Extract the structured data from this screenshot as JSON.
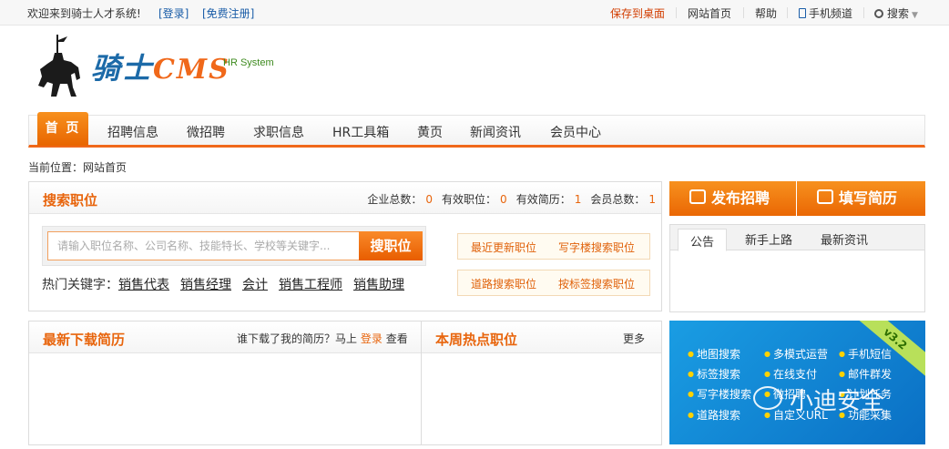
{
  "topbar": {
    "welcome": "欢迎来到骑士人才系统!",
    "login": "[登录]",
    "register": "[免费注册]",
    "save_desktop": "保存到桌面",
    "site_home": "网站首页",
    "help": "帮助",
    "mobile": "手机频道",
    "search": "搜索"
  },
  "logo": {
    "brand": "骑士",
    "brand_cms": "CMS",
    "tagline": "HR System"
  },
  "nav": {
    "items": [
      "首 页",
      "招聘信息",
      "微招聘",
      "求职信息",
      "HR工具箱",
      "黄页",
      "新闻资讯",
      "会员中心"
    ]
  },
  "breadcrumb": "当前位置：网站首页",
  "search_panel": {
    "title": "搜索职位",
    "stats": [
      {
        "label": "企业总数：",
        "value": "0"
      },
      {
        "label": "有效职位：",
        "value": "0"
      },
      {
        "label": "有效简历：",
        "value": "1"
      },
      {
        "label": "会员总数：",
        "value": "1"
      }
    ],
    "placeholder": "请输入职位名称、公司名称、技能特长、学校等关键字...",
    "button": "搜职位",
    "hot_label": "热门关键字：",
    "hot_keywords": [
      "销售代表",
      "销售经理",
      "会计",
      "销售工程师",
      "销售助理"
    ],
    "quick_links": [
      "最近更新职位",
      "写字楼搜索职位",
      "道路搜索职位",
      "按标签搜索职位"
    ]
  },
  "actions": {
    "post_job": "发布招聘",
    "write_resume": "填写简历"
  },
  "notice": {
    "tabs": [
      "公告",
      "新手上路",
      "最新资讯"
    ]
  },
  "downloads": {
    "title": "最新下载简历",
    "who_prefix": "谁下载了我的简历？马上",
    "who_login": "登录",
    "who_suffix": "查看"
  },
  "hot_jobs": {
    "title": "本周热点职位",
    "more": "更多"
  },
  "banner": {
    "version": "v3.2",
    "features": [
      "地图搜索",
      "多模式运营",
      "手机短信",
      "标签搜索",
      "在线支付",
      "邮件群发",
      "写字楼搜索",
      "微招聘",
      "计划任务",
      "道路搜索",
      "自定义URL",
      "功能采集"
    ],
    "watermark": "小迪安全"
  },
  "colors": {
    "accent": "#e8650d",
    "link": "#1a5da8",
    "banner": "#0a6fc4"
  }
}
